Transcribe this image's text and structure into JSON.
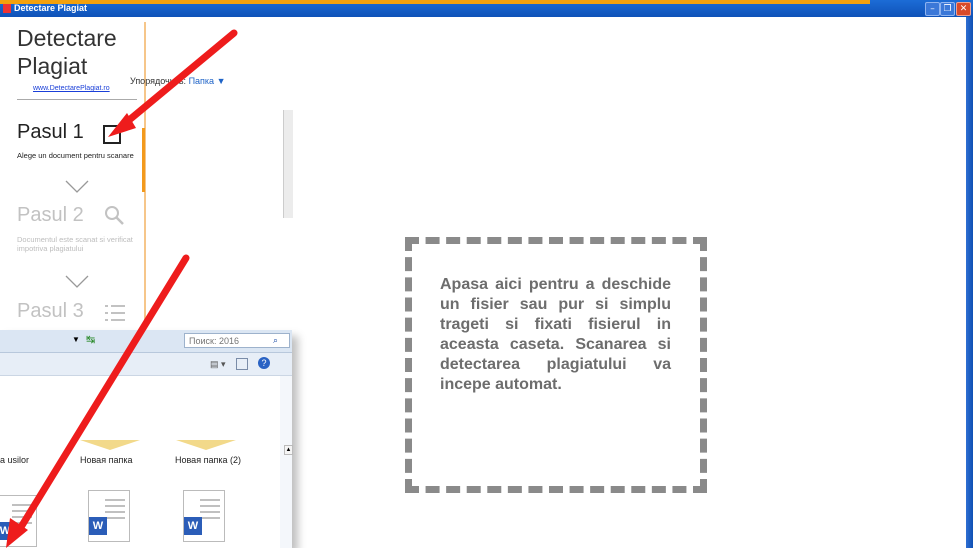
{
  "window": {
    "title": "Detectare Plagiat",
    "controls": [
      "minimize-icon",
      "maximize-icon",
      "close-icon"
    ]
  },
  "sidebar": {
    "brand_line1": "Detectare",
    "brand_line2": "Plagiat",
    "brand_link": "www.DetectarePlagiat.ro",
    "steps": [
      {
        "title": "Pasul 1",
        "desc": "Alege un document pentru scanare",
        "icon": "document-icon",
        "active": true
      },
      {
        "title": "Pasul 2",
        "desc": "Documentul este scanat si verificat impotriva plagiatului",
        "icon": "search-icon",
        "active": false
      },
      {
        "title": "Pasul 3",
        "desc": "",
        "icon": "list-icon",
        "active": false
      }
    ]
  },
  "dropzone": {
    "text": "Apasa aici pentru a deschide un fisier sau pur si simplu trageti si fixati fisierul in aceasta caseta. Scanarea si detectarea plagiatului va incepe automat."
  },
  "explorer": {
    "search_placeholder": "Поиск: 2016",
    "sort_label": "Упорядочить:",
    "sort_value": "Папка ▼",
    "folders": [
      "a usilor",
      "Новая папка",
      "Новая папка (2)"
    ],
    "file_icons": [
      "word-document-icon",
      "word-document-icon",
      "word-document-icon"
    ]
  },
  "colors": {
    "titlebar": "#0f52b8",
    "accent_orange": "#f39a1c",
    "arrow_red": "#ee1c1c",
    "dash_gray": "#8a8a8a"
  }
}
